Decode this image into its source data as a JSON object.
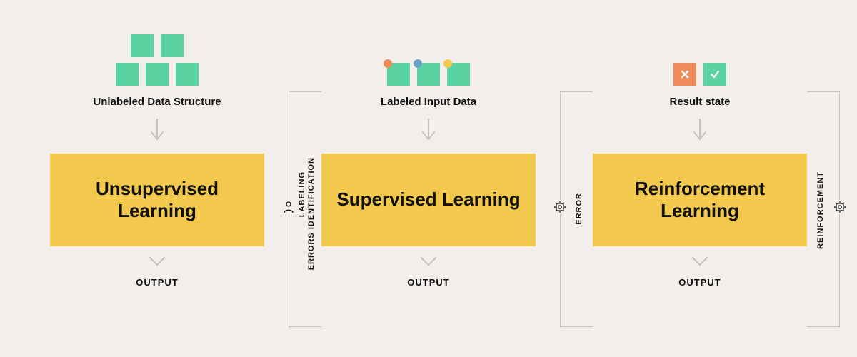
{
  "col1": {
    "input_label": "Unlabeled Data Structure",
    "box_title": "Unsupervised Learning",
    "output_label": "OUTPUT"
  },
  "col2": {
    "input_label": "Labeled Input Data",
    "box_title": "Supervised Learning",
    "output_label": "OUTPUT",
    "loop_label_line1": "LABELING",
    "loop_label_line2": "ERRORS IDENTIFICATION"
  },
  "col3": {
    "input_label": "Result state",
    "box_title": "Reinforcement Learning",
    "output_label": "OUTPUT",
    "loop_left_label": "ERROR",
    "loop_right_label": "REINFORCEMENT"
  }
}
